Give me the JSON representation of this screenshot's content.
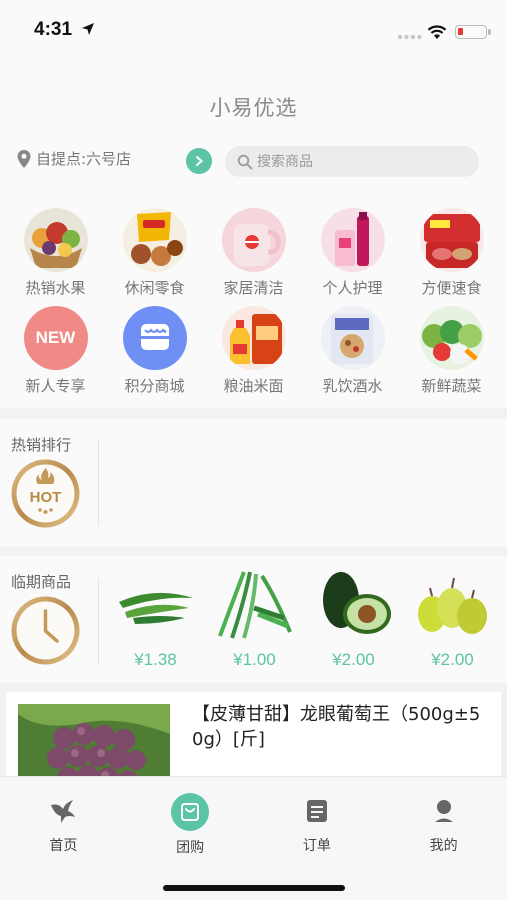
{
  "status": {
    "time": "4:31"
  },
  "header": {
    "title": "小易优选",
    "pickup_label": "自提点:六号店",
    "search_placeholder": "搜索商品"
  },
  "categories": [
    {
      "label": "热销水果",
      "icon": "fruit-basket-icon"
    },
    {
      "label": "休闲零食",
      "icon": "snacks-icon"
    },
    {
      "label": "家居清洁",
      "icon": "cleaning-icon"
    },
    {
      "label": "个人护理",
      "icon": "personal-care-icon"
    },
    {
      "label": "方便速食",
      "icon": "instant-food-icon"
    },
    {
      "label": "新人专享",
      "icon": "new-badge-icon",
      "badge": "NEW"
    },
    {
      "label": "积分商城",
      "icon": "points-store-icon"
    },
    {
      "label": "粮油米面",
      "icon": "grain-oil-icon"
    },
    {
      "label": "乳饮酒水",
      "icon": "drinks-icon"
    },
    {
      "label": "新鲜蔬菜",
      "icon": "vegetables-icon"
    }
  ],
  "hot_ranking": {
    "title": "热销排行",
    "medal_text": "HOT"
  },
  "expiring": {
    "title": "临期商品",
    "items": [
      {
        "price": "¥1.38",
        "icon": "okra-icon"
      },
      {
        "price": "¥1.00",
        "icon": "chives-icon"
      },
      {
        "price": "¥2.00",
        "icon": "avocado-icon"
      },
      {
        "price": "¥2.00",
        "icon": "pears-icon"
      }
    ]
  },
  "product": {
    "name": "【皮薄甘甜】龙眼葡萄王（500g±50g）[斤]",
    "icon": "grapes-icon"
  },
  "tabbar": {
    "items": [
      {
        "label": "首页",
        "icon": "home-bird-icon"
      },
      {
        "label": "团购",
        "icon": "group-buy-bag-icon"
      },
      {
        "label": "订单",
        "icon": "orders-icon"
      },
      {
        "label": "我的",
        "icon": "profile-icon"
      }
    ]
  },
  "colors": {
    "accent": "#5cc4a6",
    "muted_text": "#777777"
  }
}
